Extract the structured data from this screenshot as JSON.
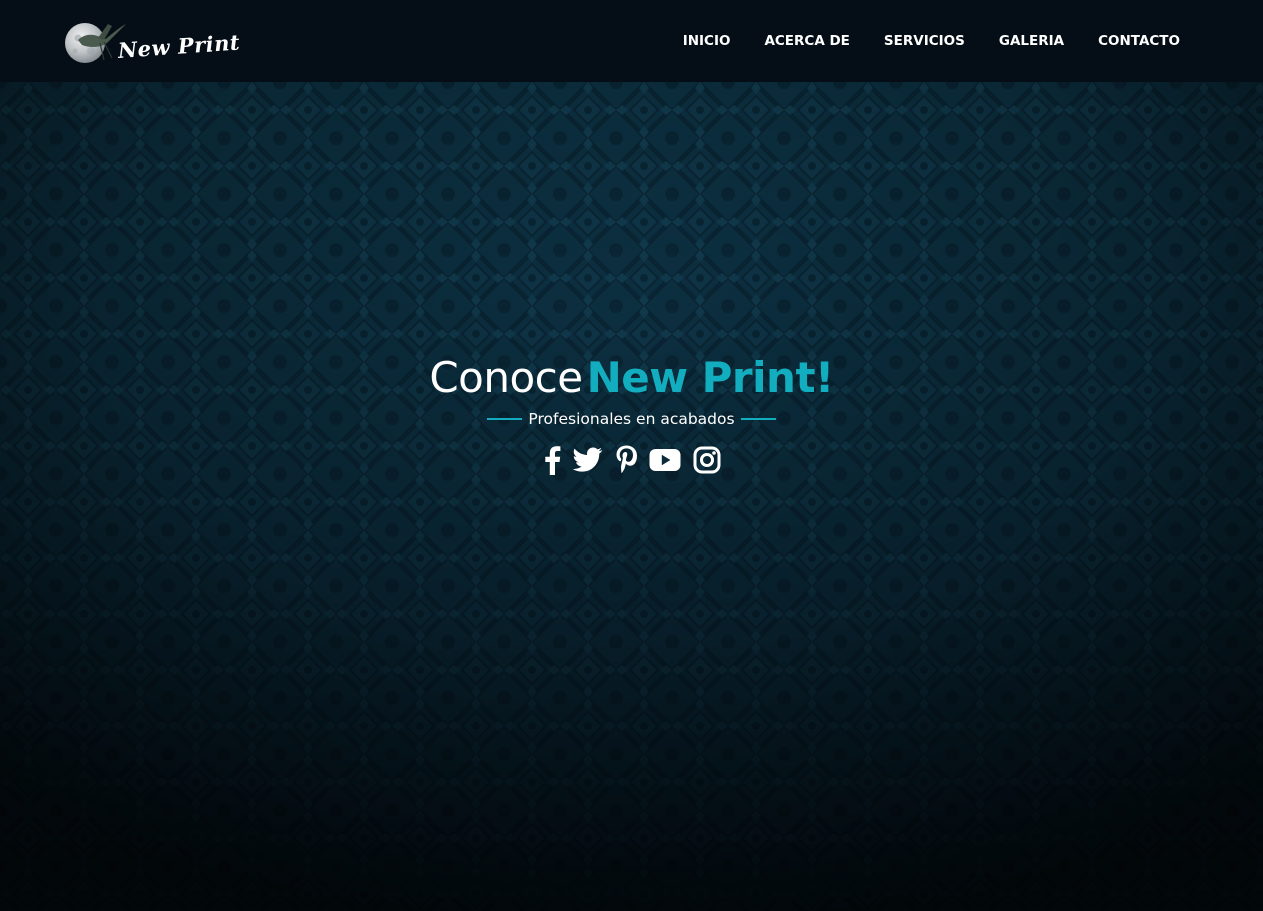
{
  "brand": {
    "name": "New Print",
    "logo_icon": "moon-heron-logo-icon"
  },
  "nav": {
    "items": [
      {
        "label": "INICIO"
      },
      {
        "label": "ACERCA DE"
      },
      {
        "label": "SERVICIOS"
      },
      {
        "label": "GALERIA"
      },
      {
        "label": "CONTACTO"
      }
    ]
  },
  "hero": {
    "title_prefix": "Conoce",
    "title_accent": "New Print!",
    "subtitle": "Profesionales en acabados",
    "social": [
      {
        "icon": "facebook-icon"
      },
      {
        "icon": "twitter-icon"
      },
      {
        "icon": "pinterest-icon"
      },
      {
        "icon": "youtube-icon"
      },
      {
        "icon": "instagram-icon"
      }
    ]
  },
  "colors": {
    "navbar_bg": "#050e17",
    "hero_bg": "#0b2a3a",
    "accent": "#12aebf",
    "text": "#ffffff"
  }
}
